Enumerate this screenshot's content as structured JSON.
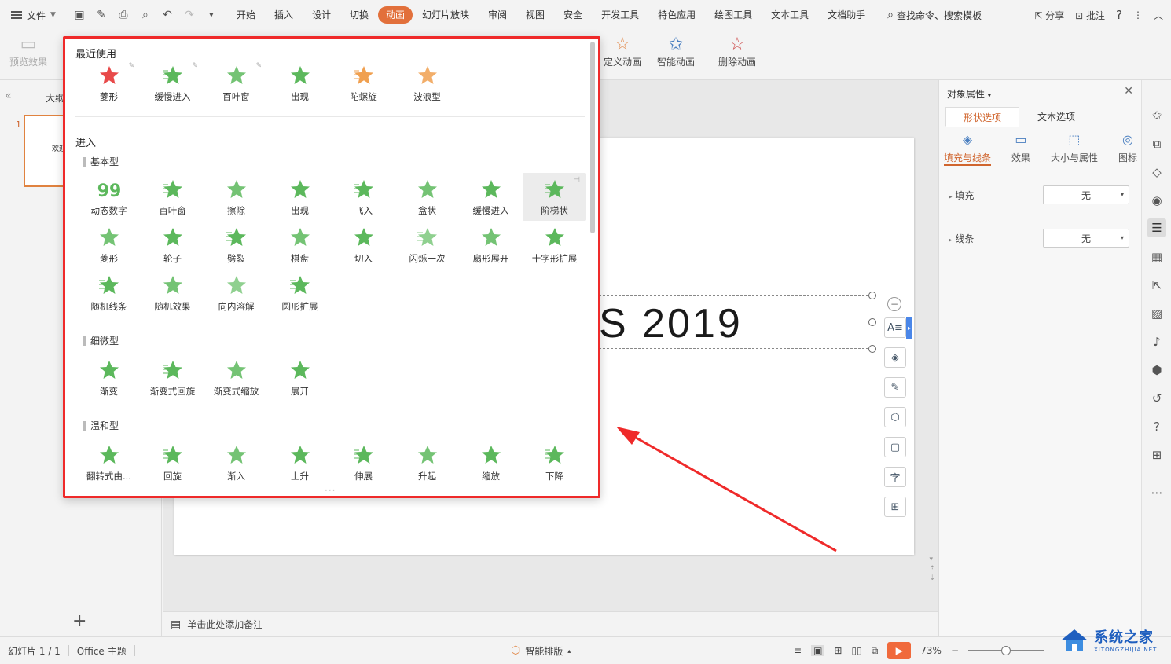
{
  "menubar": {
    "file_label": "文件",
    "tabs": [
      "开始",
      "插入",
      "设计",
      "切换",
      "动画",
      "幻灯片放映",
      "审阅",
      "视图",
      "安全",
      "开发工具",
      "特色应用",
      "绘图工具",
      "文本工具",
      "文档助手"
    ],
    "active_tab": "动画",
    "search_label": "查找命令、搜索模板",
    "share_label": "分享",
    "comment_label": "批注"
  },
  "ribbon": {
    "preview_label": "预览效果",
    "custom_anim_label": "定义动画",
    "smart_anim_label": "智能动画",
    "delete_anim_label": "删除动画"
  },
  "leftpanel": {
    "outline_tab": "大纲",
    "slide_number": "1",
    "thumb_text": "欢迎"
  },
  "slide": {
    "title_text": "S 2019"
  },
  "notes": {
    "placeholder": "单击此处添加备注"
  },
  "rpane": {
    "title": "对象属性",
    "tabs": [
      "形状选项",
      "文本选项"
    ],
    "subtabs": [
      "填充与线条",
      "效果",
      "大小与属性",
      "图标"
    ],
    "fill_label": "填充",
    "fill_value": "无",
    "line_label": "线条",
    "line_value": "无"
  },
  "status": {
    "slide_info": "幻灯片 1 / 1",
    "theme": "Office 主题",
    "smart_layout": "智能排版",
    "zoom": "73%"
  },
  "popup": {
    "recent_title": "最近使用",
    "recent": [
      {
        "label": "菱形",
        "icon": "rhombus-star-icon",
        "color": "#e84a4a"
      },
      {
        "label": "缓慢进入",
        "icon": "slow-in-star-icon",
        "color": "#5cb85c"
      },
      {
        "label": "百叶窗",
        "icon": "blinds-star-icon",
        "color": "#5cb85c"
      },
      {
        "label": "出现",
        "icon": "appear-star-icon",
        "color": "#5cb85c"
      },
      {
        "label": "陀螺旋",
        "icon": "spin-star-icon",
        "color": "#f0a050"
      },
      {
        "label": "波浪型",
        "icon": "wave-star-icon",
        "color": "#f0a050"
      }
    ],
    "enter_title": "进入",
    "basic_title": "基本型",
    "basic": [
      {
        "label": "动态数字",
        "icon": "dynamic-number-icon",
        "color": "#5cb85c"
      },
      {
        "label": "百叶窗",
        "icon": "blinds-star-icon",
        "color": "#5cb85c"
      },
      {
        "label": "擦除",
        "icon": "wipe-star-icon",
        "color": "#5cb85c"
      },
      {
        "label": "出现",
        "icon": "appear-star-icon",
        "color": "#5cb85c"
      },
      {
        "label": "飞入",
        "icon": "fly-in-star-icon",
        "color": "#5cb85c"
      },
      {
        "label": "盒状",
        "icon": "box-star-icon",
        "color": "#5cb85c"
      },
      {
        "label": "缓慢进入",
        "icon": "slow-in-star-icon",
        "color": "#5cb85c"
      },
      {
        "label": "阶梯状",
        "icon": "steps-star-icon",
        "color": "#5cb85c"
      },
      {
        "label": "菱形",
        "icon": "rhombus-star-icon",
        "color": "#5cb85c"
      },
      {
        "label": "轮子",
        "icon": "wheel-star-icon",
        "color": "#5cb85c"
      },
      {
        "label": "劈裂",
        "icon": "split-star-icon",
        "color": "#5cb85c"
      },
      {
        "label": "棋盘",
        "icon": "checkerboard-star-icon",
        "color": "#5cb85c"
      },
      {
        "label": "切入",
        "icon": "peek-in-star-icon",
        "color": "#5cb85c"
      },
      {
        "label": "闪烁一次",
        "icon": "flash-star-icon",
        "color": "#8fd08f"
      },
      {
        "label": "扇形展开",
        "icon": "fan-star-icon",
        "color": "#5cb85c"
      },
      {
        "label": "十字形扩展",
        "icon": "plus-star-icon",
        "color": "#5cb85c"
      },
      {
        "label": "随机线条",
        "icon": "random-bars-star-icon",
        "color": "#5cb85c"
      },
      {
        "label": "随机效果",
        "icon": "random-effect-star-icon",
        "color": "#5cb85c"
      },
      {
        "label": "向内溶解",
        "icon": "dissolve-star-icon",
        "color": "#8fd08f"
      },
      {
        "label": "圆形扩展",
        "icon": "circle-star-icon",
        "color": "#5cb85c"
      }
    ],
    "subtle_title": "细微型",
    "subtle": [
      {
        "label": "渐变",
        "icon": "fade-star-icon",
        "color": "#5cb85c"
      },
      {
        "label": "渐变式回旋",
        "icon": "fade-swivel-star-icon",
        "color": "#5cb85c"
      },
      {
        "label": "渐变式缩放",
        "icon": "fade-zoom-star-icon",
        "color": "#5cb85c"
      },
      {
        "label": "展开",
        "icon": "expand-star-icon",
        "color": "#5cb85c"
      }
    ],
    "moderate_title": "温和型",
    "moderate": [
      {
        "label": "翻转式由...",
        "icon": "flip-star-icon",
        "color": "#5cb85c"
      },
      {
        "label": "回旋",
        "icon": "swivel-star-icon",
        "color": "#5cb85c"
      },
      {
        "label": "渐入",
        "icon": "ease-in-star-icon",
        "color": "#5cb85c"
      },
      {
        "label": "上升",
        "icon": "rise-star-icon",
        "color": "#5cb85c"
      },
      {
        "label": "伸展",
        "icon": "stretch-star-icon",
        "color": "#5cb85c"
      },
      {
        "label": "升起",
        "icon": "rise-up-star-icon",
        "color": "#5cb85c"
      },
      {
        "label": "缩放",
        "icon": "zoom-star-icon",
        "color": "#5cb85c"
      },
      {
        "label": "下降",
        "icon": "descend-star-icon",
        "color": "#5cb85c"
      }
    ]
  },
  "watermark": {
    "big": "系统之家",
    "small": "XITONGZHIJIA.NET"
  }
}
